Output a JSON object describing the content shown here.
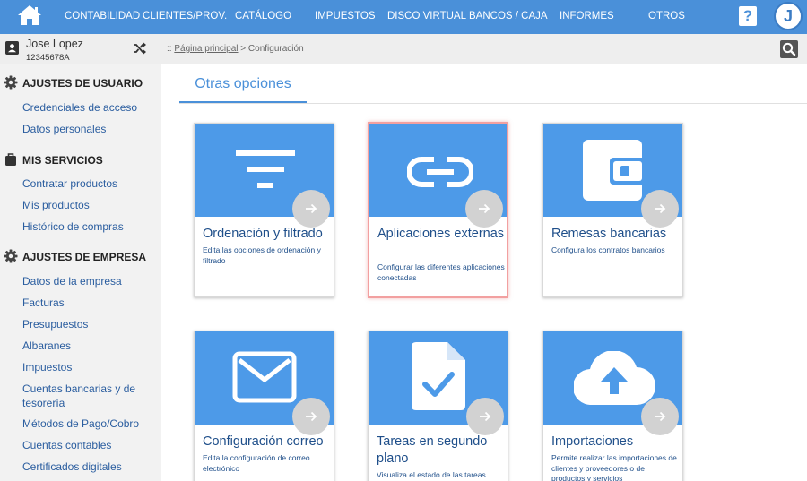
{
  "nav": {
    "items": [
      "CONTABILIDAD",
      "CLIENTES/PROV.",
      "CATÁLOGO",
      "IMPUESTOS",
      "DISCO VIRTUAL",
      "BANCOS / CAJA",
      "INFORMES",
      "OTROS"
    ],
    "help_label": "?",
    "avatar_initial": "J"
  },
  "user": {
    "name": "Jose Lopez",
    "id": "12345678A"
  },
  "breadcrumb": {
    "prefix": "::",
    "home": "Página principal",
    "separator": ">",
    "current": "Configuración"
  },
  "sidebar": {
    "sections": [
      {
        "title": "AJUSTES DE USUARIO",
        "icon": "gear-icon",
        "items": [
          "Credenciales de acceso",
          "Datos personales"
        ]
      },
      {
        "title": "MIS SERVICIOS",
        "icon": "briefcase-icon",
        "items": [
          "Contratar productos",
          "Mis productos",
          "Histórico de compras"
        ]
      },
      {
        "title": "AJUSTES DE EMPRESA",
        "icon": "gear-icon",
        "items": [
          "Datos de la empresa",
          "Facturas",
          "Presupuestos",
          "Albaranes",
          "Impuestos",
          "Cuentas bancarias y de tesorería",
          "Métodos de Pago/Cobro",
          "Cuentas contables",
          "Certificados digitales"
        ]
      }
    ]
  },
  "main": {
    "tab": "Otras opciones",
    "cards": [
      {
        "title": "Ordenación y filtrado",
        "desc": "Edita las opciones de ordenación y filtrado",
        "icon": "filter-icon",
        "selected": false
      },
      {
        "title": "Aplicaciones externas",
        "desc": "Configurar las diferentes aplicaciones conectadas",
        "icon": "link-icon",
        "selected": true
      },
      {
        "title": "Remesas bancarias",
        "desc": "Configura los contratos bancarios",
        "icon": "wallet-icon",
        "selected": false
      },
      {
        "title": "Configuración correo",
        "desc": "Edita la configuración de correo electrónico",
        "icon": "envelope-icon",
        "selected": false
      },
      {
        "title": "Tareas en segundo plano",
        "desc": "Visualiza el estado de las tareas",
        "icon": "document-check-icon",
        "selected": false
      },
      {
        "title": "Importaciones",
        "desc": "Permite realizar las importaciones de clientes y proveedores o de productos y servicios",
        "icon": "cloud-upload-icon",
        "selected": false
      }
    ]
  },
  "colors": {
    "nav_bg": "#4a90d9",
    "card_banner": "#4d9ae8",
    "link": "#2a5d9f",
    "card_text": "#1f4f8a",
    "selected_border": "#f2a0a0"
  }
}
